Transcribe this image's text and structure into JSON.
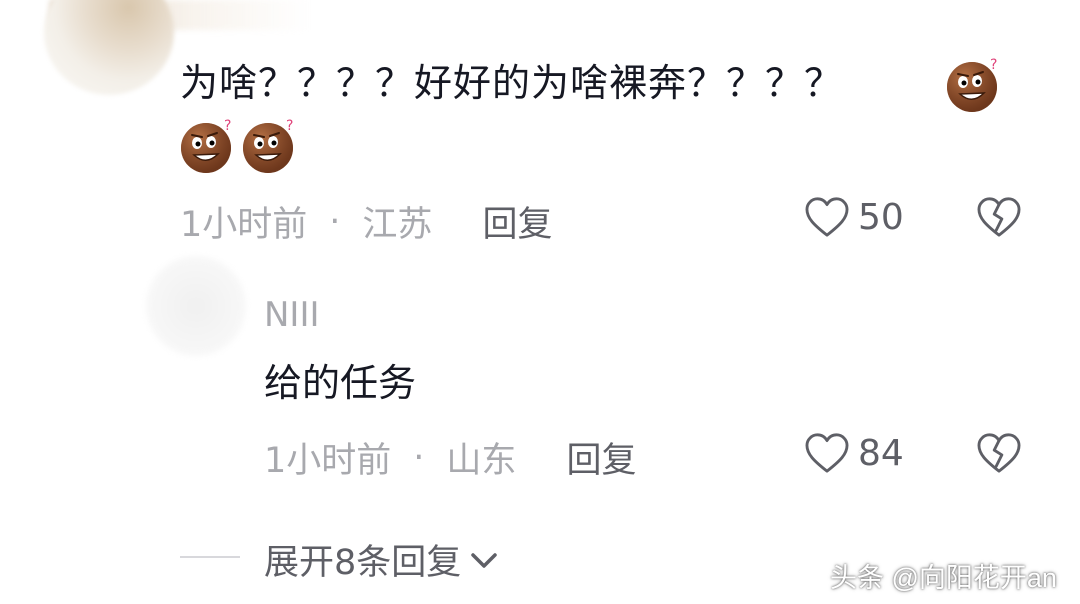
{
  "comments": [
    {
      "text": "为啥？？？？好好的为啥裸奔？？？？",
      "emojis": [
        "confused-face-emoji",
        "confused-face-emoji",
        "confused-face-emoji"
      ],
      "time": "1小时前",
      "separator": "·",
      "location": "江苏",
      "reply_label": "回复",
      "likes": "50"
    }
  ],
  "reply": {
    "username": "NIII",
    "text": "给的任务",
    "time": "1小时前",
    "separator": "·",
    "location": "山东",
    "reply_label": "回复",
    "likes": "84"
  },
  "expand_label": "展开8条回复",
  "watermark": "头条 @向阳花开an",
  "colors": {
    "text": "#161823",
    "meta": "#a8a9ae",
    "action": "#5e5f66",
    "emoji_face": "#8a4a2a"
  }
}
